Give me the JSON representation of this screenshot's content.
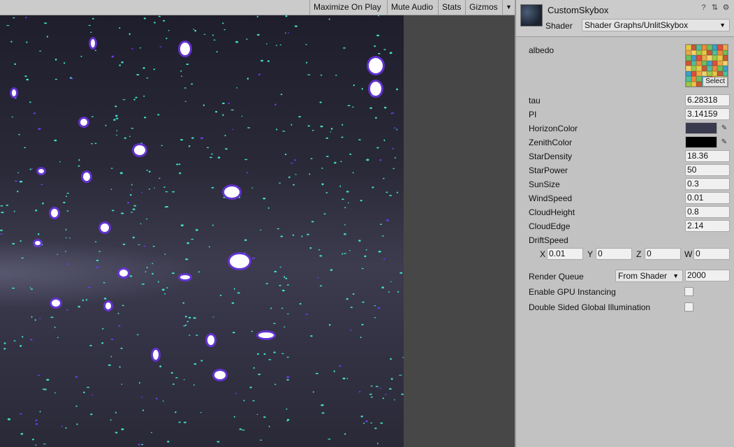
{
  "game_toolbar": {
    "maximize_label": "Maximize On Play",
    "mute_label": "Mute Audio",
    "stats_label": "Stats",
    "gizmos_label": "Gizmos",
    "gizmos_arrow": "▼"
  },
  "inspector": {
    "material_name": "CustomSkybox",
    "shader_label": "Shader",
    "shader_value": "Shader Graphs/UnlitSkybox",
    "header_icons": [
      "help-icon",
      "presets-icon",
      "settings-icon"
    ],
    "albedo_label": "albedo",
    "albedo_select": "Select",
    "props": {
      "tau": {
        "label": "tau",
        "value": "6.28318"
      },
      "pi": {
        "label": "PI",
        "value": "3.14159"
      },
      "horizon": {
        "label": "HorizonColor",
        "color": "#3a3a4e"
      },
      "zenith": {
        "label": "ZenithColor",
        "color": "#000000"
      },
      "star_density": {
        "label": "StarDensity",
        "value": "18.36"
      },
      "star_power": {
        "label": "StarPower",
        "value": "50"
      },
      "sun_size": {
        "label": "SunSize",
        "value": "0.3"
      },
      "wind_speed": {
        "label": "WindSpeed",
        "value": "0.01"
      },
      "cloud_height": {
        "label": "CloudHeight",
        "value": "0.8"
      },
      "cloud_edge": {
        "label": "CloudEdge",
        "value": "2.14"
      },
      "drift_speed": {
        "label": "DriftSpeed"
      }
    },
    "drift": {
      "x_label": "X",
      "x": "0.01",
      "y_label": "Y",
      "y": "0",
      "z_label": "Z",
      "z": "0",
      "w_label": "W",
      "w": "0"
    },
    "render_queue": {
      "label": "Render Queue",
      "mode": "From Shader",
      "value": "2000"
    },
    "gpu_instancing": {
      "label": "Enable GPU Instancing",
      "checked": false
    },
    "double_sided_gi": {
      "label": "Double Sided Global Illumination",
      "checked": false
    }
  }
}
